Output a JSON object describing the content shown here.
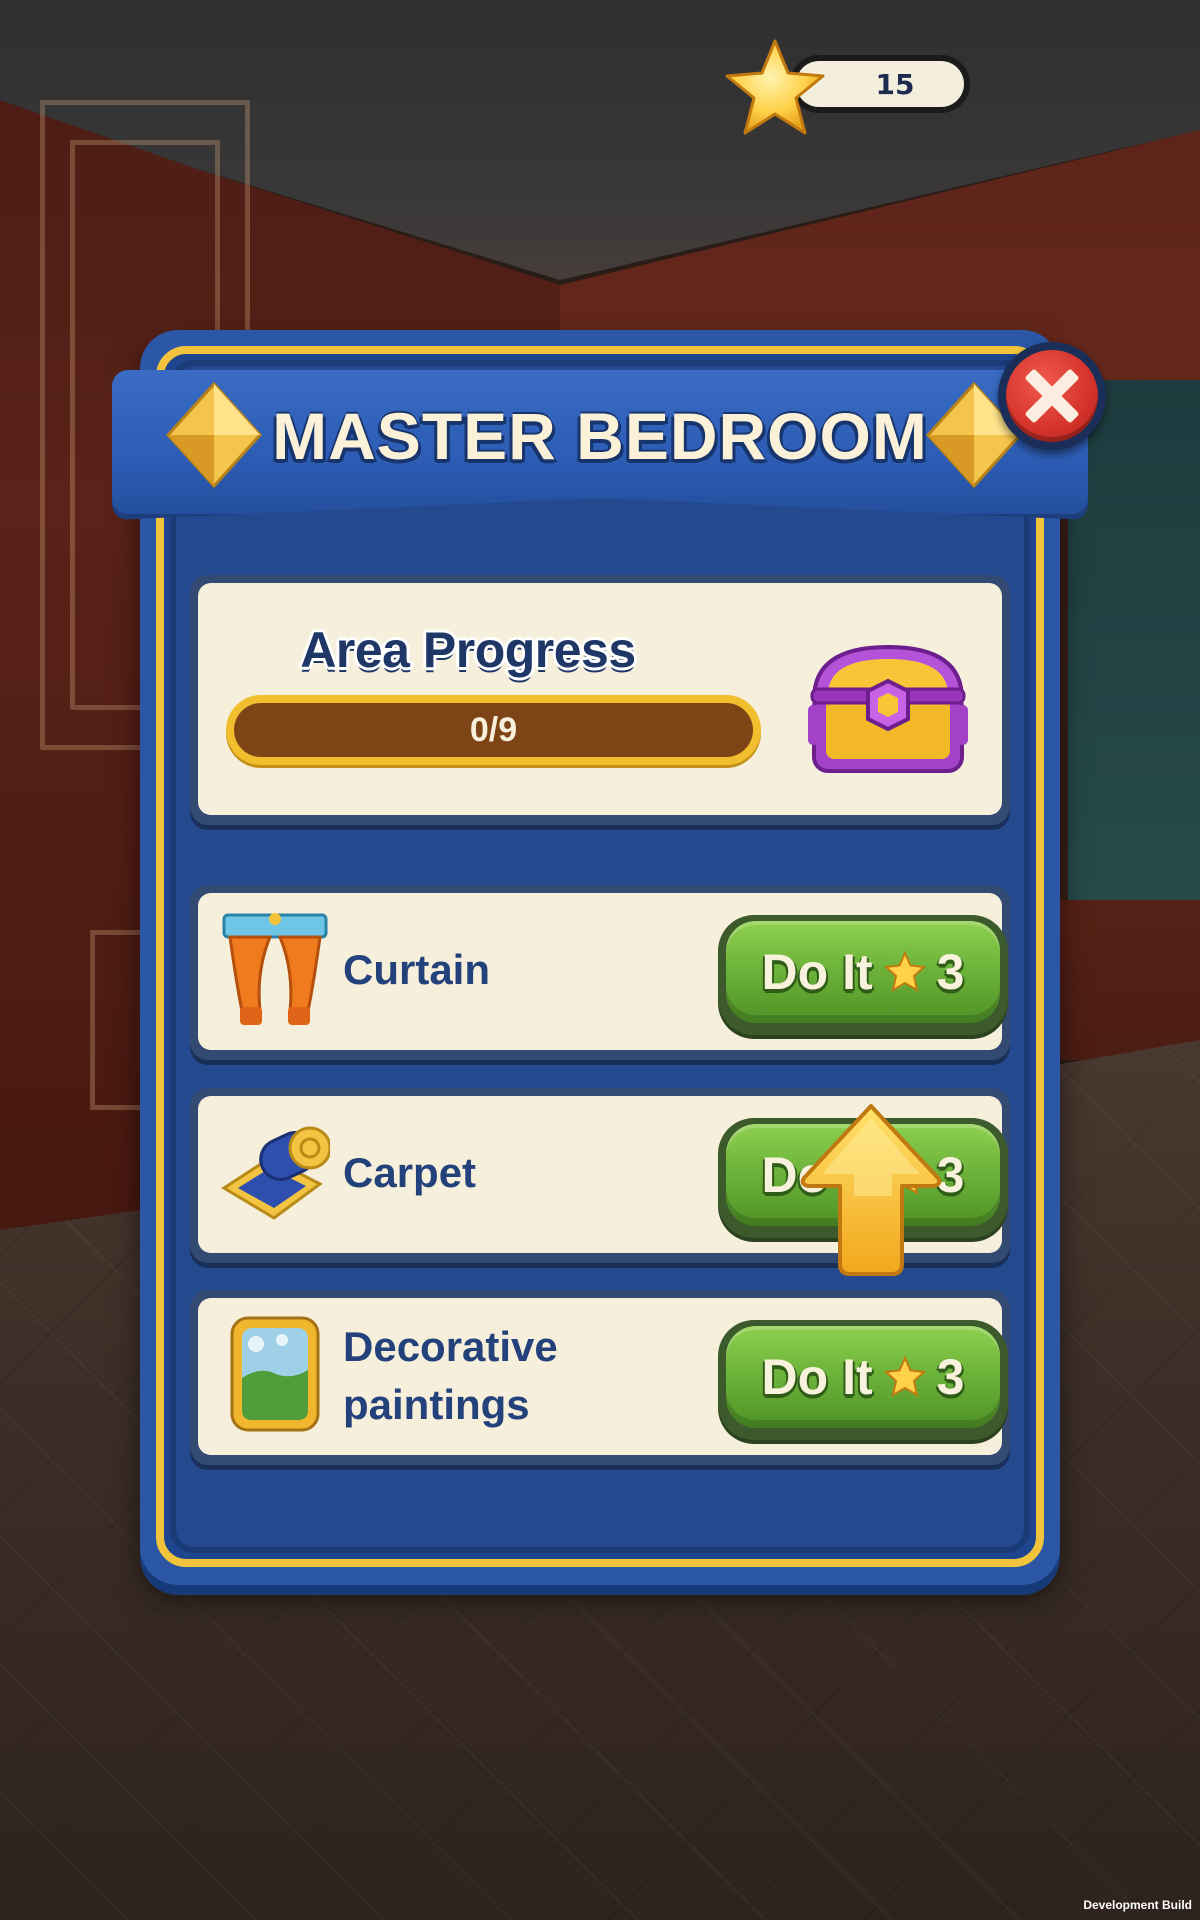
{
  "currency": {
    "stars": "15",
    "icon": "star-icon"
  },
  "dialog": {
    "title": "MASTER BEDROOM",
    "close_icon": "close-icon",
    "progress": {
      "title": "Area Progress",
      "text": "0/9",
      "fraction": 0,
      "reward_icon": "treasure-chest-icon"
    },
    "tasks": [
      {
        "label": "Curtain",
        "icon": "curtain-icon",
        "button": "Do It",
        "cost": "3"
      },
      {
        "label": "Carpet",
        "icon": "carpet-roll-icon",
        "button": "Do It",
        "cost": "3"
      },
      {
        "label": "Decorative\npaintings",
        "label_lines": [
          "Decorative",
          "paintings"
        ],
        "icon": "painting-icon",
        "button": "Do It",
        "cost": "3"
      }
    ],
    "hint_icon": "pointer-arrow-icon"
  },
  "footer": {
    "build": "Development Build"
  },
  "colors": {
    "panel_blue": "#2b57a6",
    "gold_border": "#f1c43c",
    "card_bg": "#f6efdc",
    "button_green": "#6eb43b",
    "close_red": "#d4322a",
    "title_text": "#fbf1d8",
    "label_text": "#23417a"
  }
}
